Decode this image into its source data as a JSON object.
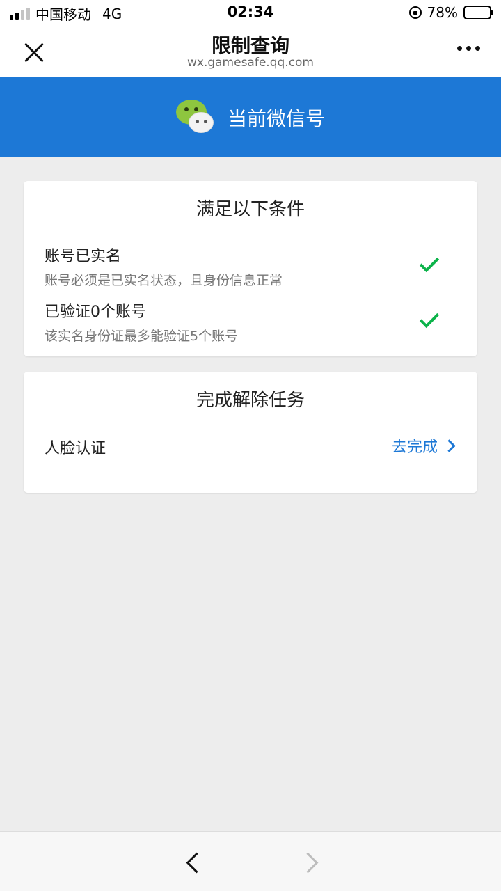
{
  "status_bar": {
    "carrier": "中国移动",
    "network": "4G",
    "time": "02:34",
    "battery": "78%",
    "battery_level": 0.78
  },
  "nav": {
    "title": "限制查询",
    "subtitle": "wx.gamesafe.qq.com"
  },
  "banner": {
    "text": "当前微信号",
    "color": "#1d78d6"
  },
  "conditions_card": {
    "title": "满足以下条件",
    "items": [
      {
        "title": "账号已实名",
        "desc": "账号必须是已实名状态，且身份信息正常",
        "status": "check-icon"
      },
      {
        "title": "已验证0个账号",
        "desc": "该实名身份证最多能验证5个账号",
        "status": "check-icon"
      }
    ]
  },
  "task_card": {
    "title": "完成解除任务",
    "task_label": "人脸认证",
    "action_label": "去完成"
  },
  "toolbar": {
    "back": "chevron-left-icon",
    "forward": "chevron-right-icon"
  }
}
